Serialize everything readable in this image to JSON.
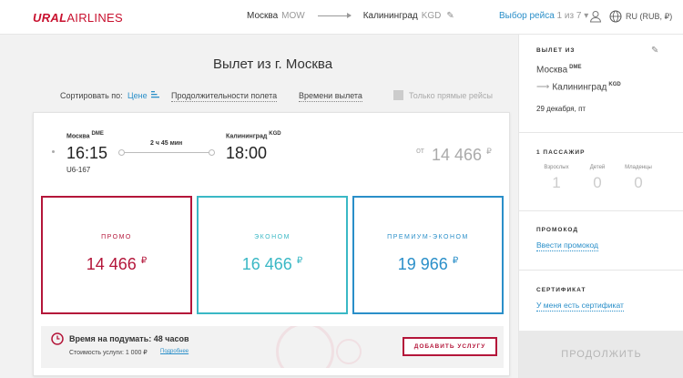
{
  "header": {
    "logo_bold": "URAL",
    "logo_rest": "AIRLINES",
    "origin_city": "Москва",
    "origin_code": "MOW",
    "dest_city": "Калининград",
    "dest_code": "KGD",
    "flight_select_label": "Выбор рейса",
    "flight_select_of": "1 из 7",
    "locale": "RU (RUB, ₽)",
    "user_icon": "user-icon",
    "globe_icon": "globe-icon"
  },
  "main": {
    "title": "Вылет из г. Москва",
    "sort_label": "Сортировать по:",
    "sort_options": [
      "Цене",
      "Продолжительности полета",
      "Времени вылета"
    ],
    "direct_only_label": "Только прямые рейсы",
    "direct_only_checked": false
  },
  "flight": {
    "dep_city": "Москва",
    "dep_code": "DME",
    "dep_time": "16:15",
    "flight_no": "U6-167",
    "duration": "2 ч 45 мин",
    "arr_city": "Калининград",
    "arr_code": "KGD",
    "arr_time": "18:00",
    "from_label": "от",
    "from_price": "14 466",
    "currency": "₽"
  },
  "fares": [
    {
      "name": "ПРОМО",
      "price": "14 466",
      "color": "#b4163a"
    },
    {
      "name": "ЭКОНОМ",
      "price": "16 466",
      "color": "#3ab8c5"
    },
    {
      "name": "ПРЕМИУМ-ЭКОНОМ",
      "price": "19 966",
      "color": "#2a8fc9"
    }
  ],
  "think": {
    "title": "Время на подумать: 48 часов",
    "cost": "Стоимость услуги: 1 000 ₽",
    "more": "Подробнее",
    "button": "ДОБАВИТЬ УСЛУГУ"
  },
  "sidebar": {
    "departure_title": "ВЫЛЕТ ИЗ",
    "from_city": "Москва",
    "from_code": "DME",
    "to_city": "Калининград",
    "to_code": "KGD",
    "date": "29 декабря, пт",
    "passengers_title": "1 ПАССАЖИР",
    "pax": [
      {
        "label": "Взрослых",
        "value": "1"
      },
      {
        "label": "Детей",
        "value": "0"
      },
      {
        "label": "Младенцы",
        "value": "0"
      }
    ],
    "promo_title": "ПРОМОКОД",
    "promo_link": "Ввести промокод",
    "cert_title": "СЕРТИФИКАТ",
    "cert_link": "У меня есть сертификат",
    "continue": "ПРОДОЛЖИТЬ"
  },
  "colors": {
    "brand": "#c8102e",
    "link": "#2a8fc9",
    "promo": "#b4163a",
    "econ": "#3ab8c5"
  }
}
